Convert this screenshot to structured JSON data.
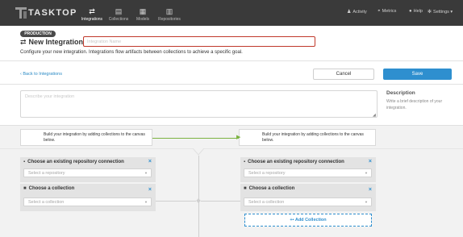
{
  "app": {
    "brand": "TASKTOP"
  },
  "nav": {
    "tabs": [
      {
        "label": "Integrations",
        "icon": "integrations-icon",
        "active": true
      },
      {
        "label": "Collections",
        "icon": "collections-icon",
        "active": false
      },
      {
        "label": "Models",
        "icon": "models-icon",
        "active": false
      },
      {
        "label": "Repositories",
        "icon": "repositories-icon",
        "active": false
      }
    ],
    "right": {
      "activity": "Activity",
      "metrics": "Metrics",
      "help": "Help",
      "settings": "Settings"
    }
  },
  "header": {
    "environment_badge": "PRODUCTION",
    "title": "New Integration",
    "name_placeholder": "Integration Name",
    "subtitle": "Configure your new integration. Integrations flow artifacts between collections to achieve a specific goal."
  },
  "actions": {
    "back": "Back to Integrations",
    "cancel": "Cancel",
    "save": "Save"
  },
  "description": {
    "placeholder": "Describe your integration",
    "help_title": "Description",
    "help_text": "Write a brief description of your integration."
  },
  "canvas": {
    "left_hint": "Build your integration by adding collections to the canvas below.",
    "right_hint": "Build your integration by adding collections to the canvas below.",
    "left": {
      "repo_title": "Choose an existing repository connection",
      "repo_placeholder": "Select a repository",
      "collection_title": "Choose a collection",
      "collection_placeholder": "Select a collection"
    },
    "right": {
      "repo_title": "Choose an existing repository connection",
      "repo_placeholder": "Select a repository",
      "collection_title": "Choose a collection",
      "collection_placeholder": "Select a collection",
      "add_collection": "Add Collection"
    },
    "flow_color": "#7cb342"
  },
  "colors": {
    "accent": "#2e8fcf",
    "nav_bg": "#3a3a3a",
    "error_border": "#c0392b"
  }
}
